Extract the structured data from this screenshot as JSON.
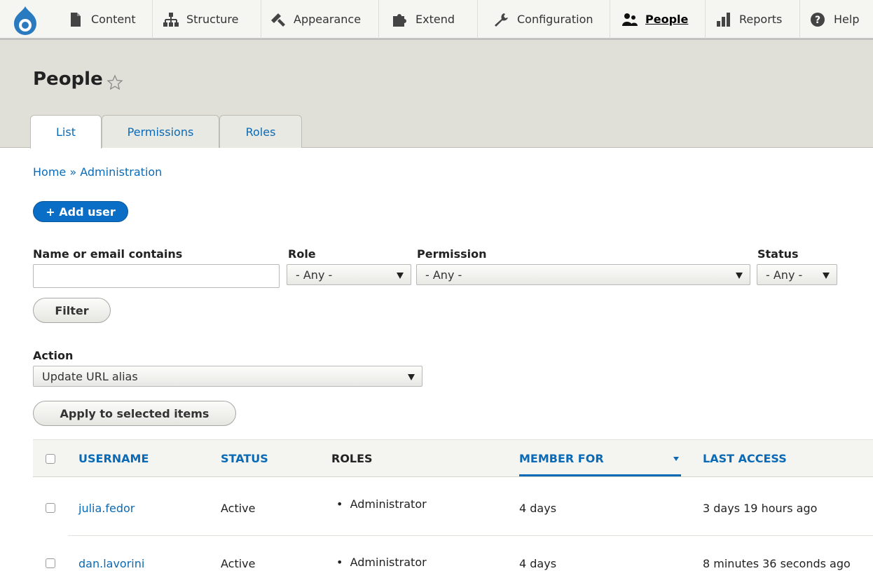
{
  "toolbar": {
    "items": [
      {
        "label": "Content",
        "icon": "document-icon"
      },
      {
        "label": "Structure",
        "icon": "structure-icon"
      },
      {
        "label": "Appearance",
        "icon": "brush-icon"
      },
      {
        "label": "Extend",
        "icon": "puzzle-icon"
      },
      {
        "label": "Configuration",
        "icon": "wrench-icon"
      },
      {
        "label": "People",
        "icon": "people-icon"
      },
      {
        "label": "Reports",
        "icon": "bar-chart-icon"
      },
      {
        "label": "Help",
        "icon": "help-icon"
      }
    ],
    "active": "People"
  },
  "header": {
    "title": "People",
    "tabs": [
      "List",
      "Permissions",
      "Roles"
    ],
    "active_tab": "List"
  },
  "breadcrumb": {
    "home": "Home",
    "separator": "»",
    "current": "Administration"
  },
  "add_user_label": "+ Add user",
  "filters": {
    "name_label": "Name or email contains",
    "name_value": "",
    "role_label": "Role",
    "role_value": "- Any -",
    "permission_label": "Permission",
    "permission_value": "- Any -",
    "status_label": "Status",
    "status_value": "- Any -",
    "filter_button": "Filter"
  },
  "bulk": {
    "action_label": "Action",
    "action_value": "Update URL alias",
    "apply_button": "Apply to selected items"
  },
  "table": {
    "columns": [
      "USERNAME",
      "STATUS",
      "ROLES",
      "MEMBER FOR",
      "LAST ACCESS"
    ],
    "rows": [
      {
        "username": "julia.fedor",
        "status": "Active",
        "role": "Administrator",
        "member_for": "4 days",
        "last_access": "3 days 19 hours ago"
      },
      {
        "username": "dan.lavorini",
        "status": "Active",
        "role": "Administrator",
        "member_for": "4 days",
        "last_access": "8 minutes 36 seconds ago"
      }
    ]
  },
  "colors": {
    "link": "#0a6ab6",
    "accent": "#0b6ec6",
    "header_bg": "#e0e0d8"
  }
}
